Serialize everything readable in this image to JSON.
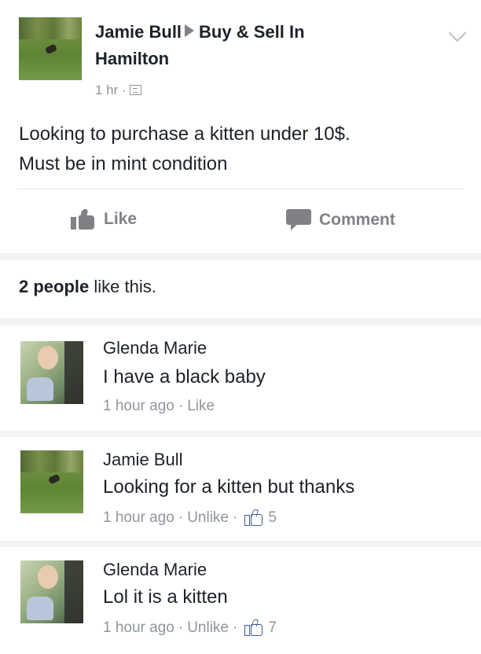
{
  "post": {
    "author": "Jamie Bull",
    "group": "Buy & Sell In",
    "group_line2": "Hamilton",
    "time": "1 hr ·",
    "text": "Looking to purchase a kitten under 10$.\nMust be in mint condition",
    "actions": {
      "like": "Like",
      "comment": "Comment"
    }
  },
  "likes": {
    "count_text": "2 people",
    "suffix": " like this."
  },
  "comments": [
    {
      "name": "Glenda Marie",
      "text": "I have a black baby",
      "time": "1 hour ago",
      "action": "Like",
      "reactions": ""
    },
    {
      "name": "Jamie Bull",
      "text": "Looking for a kitten but thanks",
      "time": "1 hour ago",
      "action": "Unlike",
      "reactions": "5"
    },
    {
      "name": "Glenda Marie",
      "text": "Lol it is a kitten",
      "time": "1 hour ago",
      "action": "Unlike",
      "reactions": "7"
    }
  ],
  "icons": {
    "arrow": "right-triangle-icon",
    "audience": "group-audience-icon",
    "menu": "chevron-down-icon",
    "like": "thumbs-up-icon",
    "comment": "speech-bubble-icon"
  },
  "colors": {
    "link_blue": "#3b5998",
    "meta_gray": "#90949c",
    "text": "#1d2129"
  }
}
